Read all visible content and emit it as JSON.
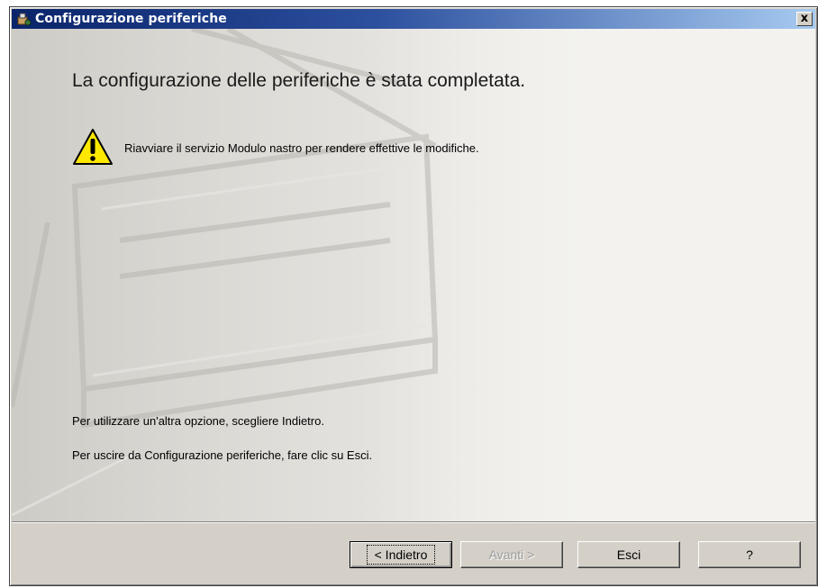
{
  "window": {
    "title": "Configurazione periferiche",
    "close_label": "x"
  },
  "content": {
    "heading": "La configurazione delle periferiche è stata completata.",
    "warning_text": "Riavviare il servizio Modulo nastro per rendere effettive le modifiche.",
    "hint_back": "Per utilizzare un'altra opzione, scegliere Indietro.",
    "hint_exit": "Per uscire da Configurazione periferiche, fare clic su Esci."
  },
  "buttons": {
    "back": "< Indietro",
    "next": "Avanti >",
    "exit": "Esci",
    "help": "?"
  },
  "colors": {
    "titlebar_start": "#0a246a",
    "titlebar_end": "#a6caf0",
    "dialog_bg": "#d4d0c8",
    "content_bg": "#f3f2ef",
    "warning_yellow": "#ffe800"
  },
  "icons": {
    "app": "device-config-icon",
    "warning": "warning-triangle-icon",
    "close": "close-icon"
  }
}
